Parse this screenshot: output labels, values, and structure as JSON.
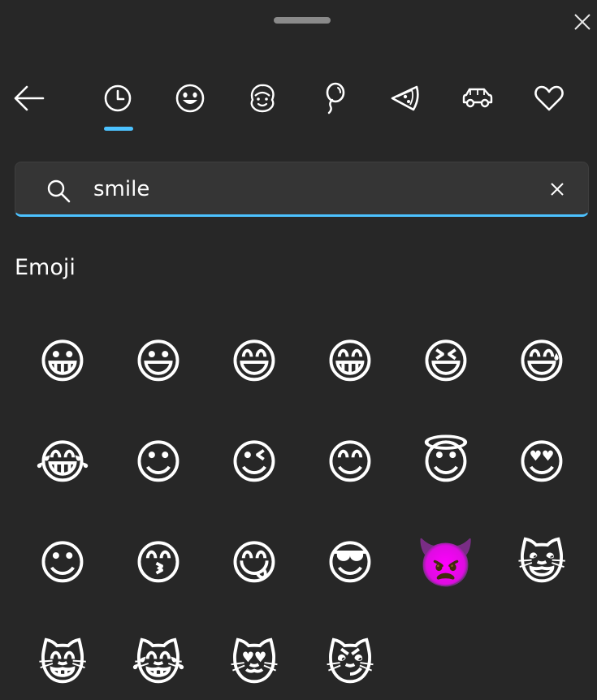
{
  "window": {
    "close_label": "Close",
    "close_glyph": "✕"
  },
  "nav": {
    "back_label": "Back",
    "tabs": [
      {
        "label": "Most recently used",
        "icon": "clock-icon",
        "selected": true
      },
      {
        "label": "Smileys and animals",
        "icon": "smiley-icon",
        "selected": false
      },
      {
        "label": "People",
        "icon": "person-face-icon",
        "selected": false
      },
      {
        "label": "Celebrations and objects",
        "icon": "balloon-icon",
        "selected": false
      },
      {
        "label": "Food and plants",
        "icon": "pizza-icon",
        "selected": false
      },
      {
        "label": "Transportation and places",
        "icon": "car-icon",
        "selected": false
      },
      {
        "label": "Symbols",
        "icon": "heart-icon",
        "selected": false
      }
    ],
    "accent_color": "#4cc2ff"
  },
  "search": {
    "value": "smile",
    "clear_glyph": "✕",
    "clear_label": "Clear search"
  },
  "section": {
    "heading": "Emoji"
  },
  "emoji": [
    "😀",
    "😃",
    "😄",
    "😁",
    "😆",
    "😅",
    "😂",
    "☺",
    "😉",
    "😊",
    "😇",
    "😍",
    "☺",
    "😙",
    "😋",
    "😎",
    "👿",
    "😺",
    "😸",
    "😹",
    "😻",
    "😼"
  ],
  "colors": {
    "background": "#272727",
    "search_bg": "#353535",
    "text": "#ffffff",
    "accent": "#4cc2ff"
  }
}
